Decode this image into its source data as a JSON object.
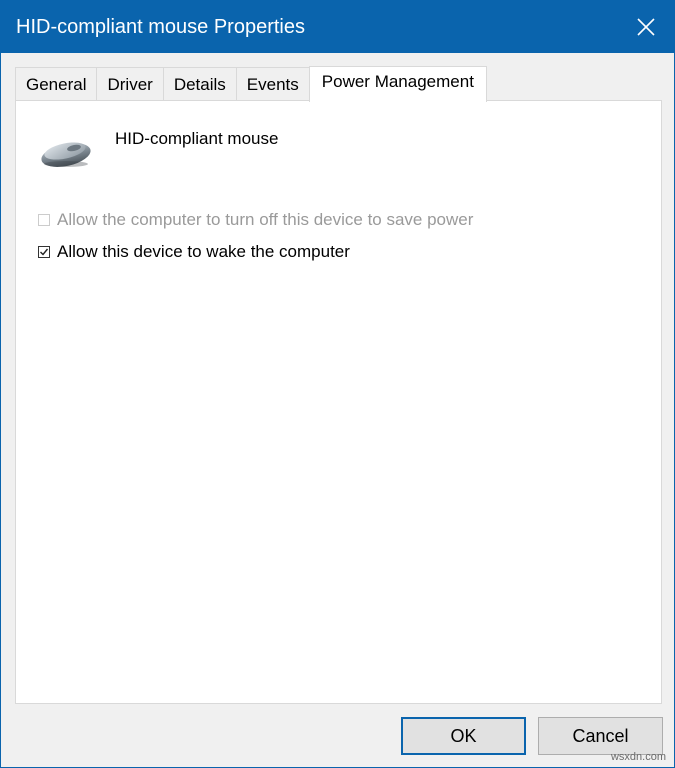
{
  "window": {
    "title": "HID-compliant mouse Properties"
  },
  "tabs": [
    {
      "label": "General"
    },
    {
      "label": "Driver"
    },
    {
      "label": "Details"
    },
    {
      "label": "Events"
    },
    {
      "label": "Power Management",
      "active": true
    }
  ],
  "device": {
    "name": "HID-compliant mouse",
    "icon": "mouse-icon"
  },
  "options": [
    {
      "label": "Allow the computer to turn off this device to save power",
      "checked": false,
      "enabled": false
    },
    {
      "label": "Allow this device to wake the computer",
      "checked": true,
      "enabled": true
    }
  ],
  "buttons": {
    "ok": "OK",
    "cancel": "Cancel"
  },
  "watermark": "wsxdn.com",
  "colors": {
    "titlebar": "#0a64ad",
    "panel": "#ffffff",
    "dialog": "#f0f0f0"
  }
}
